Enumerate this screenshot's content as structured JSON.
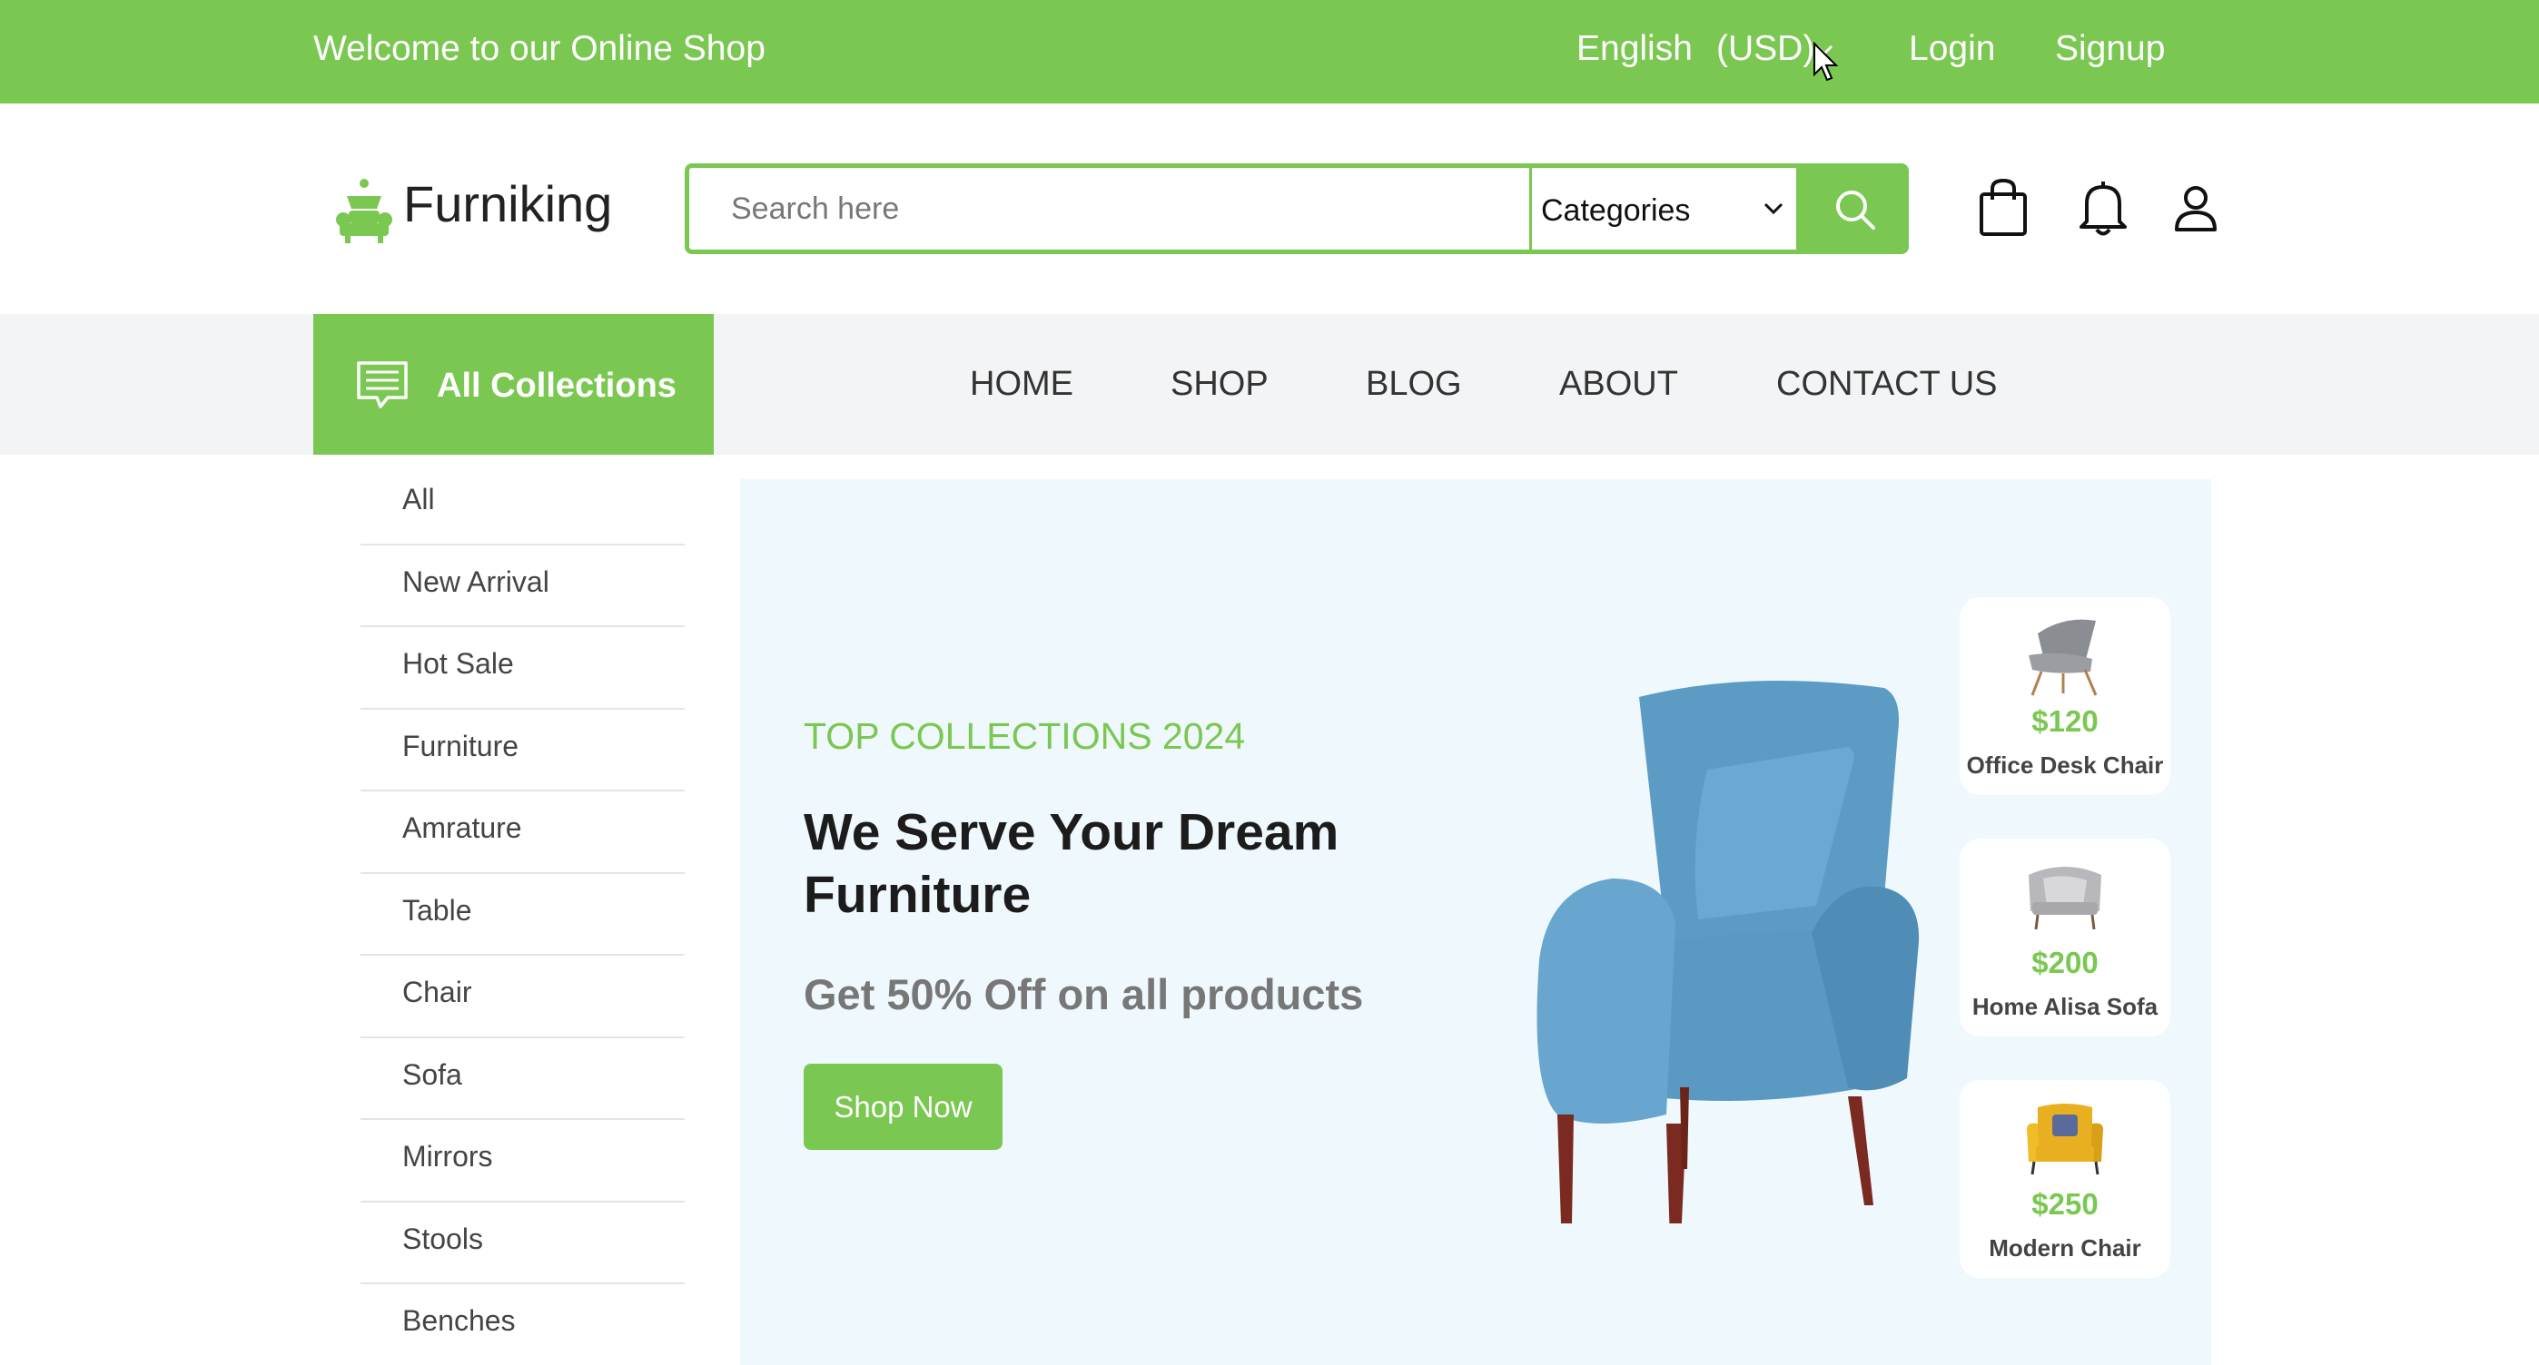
{
  "topbar": {
    "welcome": "Welcome to our Online Shop",
    "language": "English",
    "currency": "(USD)",
    "login": "Login",
    "signup": "Signup"
  },
  "header": {
    "brand": "Furniking",
    "search_placeholder": "Search here",
    "category_select": "Categories",
    "icons": [
      "shopping-bag-icon",
      "bell-icon",
      "user-icon"
    ]
  },
  "nav": {
    "all_collections": "All Collections",
    "links": [
      "HOME",
      "SHOP",
      "BLOG",
      "ABOUT",
      "CONTACT US"
    ]
  },
  "sidebar": {
    "items": [
      "All",
      "New Arrival",
      "Hot Sale",
      "Furniture",
      "Amrature",
      "Table",
      "Chair",
      "Sofa",
      "Mirrors",
      "Stools",
      "Benches"
    ]
  },
  "hero": {
    "eyebrow": "TOP COLLECTIONS 2024",
    "title": "We Serve Your Dream Furniture",
    "offer": "Get 50% Off on all products",
    "cta": "Shop Now"
  },
  "products": [
    {
      "price": "$120",
      "name": "Office Desk Chair"
    },
    {
      "price": "$200",
      "name": "Home Alisa Sofa"
    },
    {
      "price": "$250",
      "name": "Modern Chair"
    }
  ],
  "colors": {
    "accent": "#7ac751",
    "hero_bg": "#eff8fc",
    "nav_bg": "#f3f4f6"
  }
}
